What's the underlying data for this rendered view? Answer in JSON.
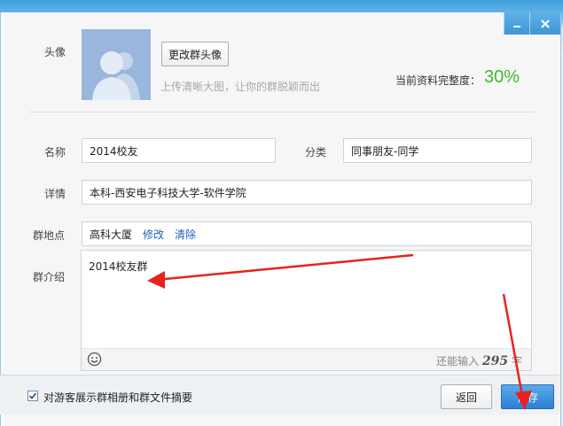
{
  "avatar_section": {
    "label": "头像",
    "change_button": "更改群头像",
    "hint": "上传清晰大图，让你的群脱颖而出",
    "completeness_label": "当前资料完整度：",
    "completeness_value": "30%"
  },
  "form": {
    "name_label": "名称",
    "name_value": "2014校友",
    "category_label": "分类",
    "category_value": "同事朋友-同学",
    "detail_label": "详情",
    "detail_value": "本科-西安电子科技大学-软件学院",
    "location_label": "群地点",
    "location_value": "高科大厦",
    "location_edit": "修改",
    "location_clear": "清除",
    "intro_label": "群介绍",
    "intro_value": "2014校友群",
    "counter_prefix": "还能输入",
    "counter_value": "295",
    "counter_suffix": "字"
  },
  "footer": {
    "checkbox_label": "对游客展示群相册和群文件摘要",
    "checkbox_checked": true,
    "back_button": "返回",
    "save_button": "保存"
  },
  "colors": {
    "accent": "#2f7fd2",
    "completeness": "#3dbb2b",
    "link": "#1a62b5",
    "annotation_arrow": "#e8231e"
  }
}
